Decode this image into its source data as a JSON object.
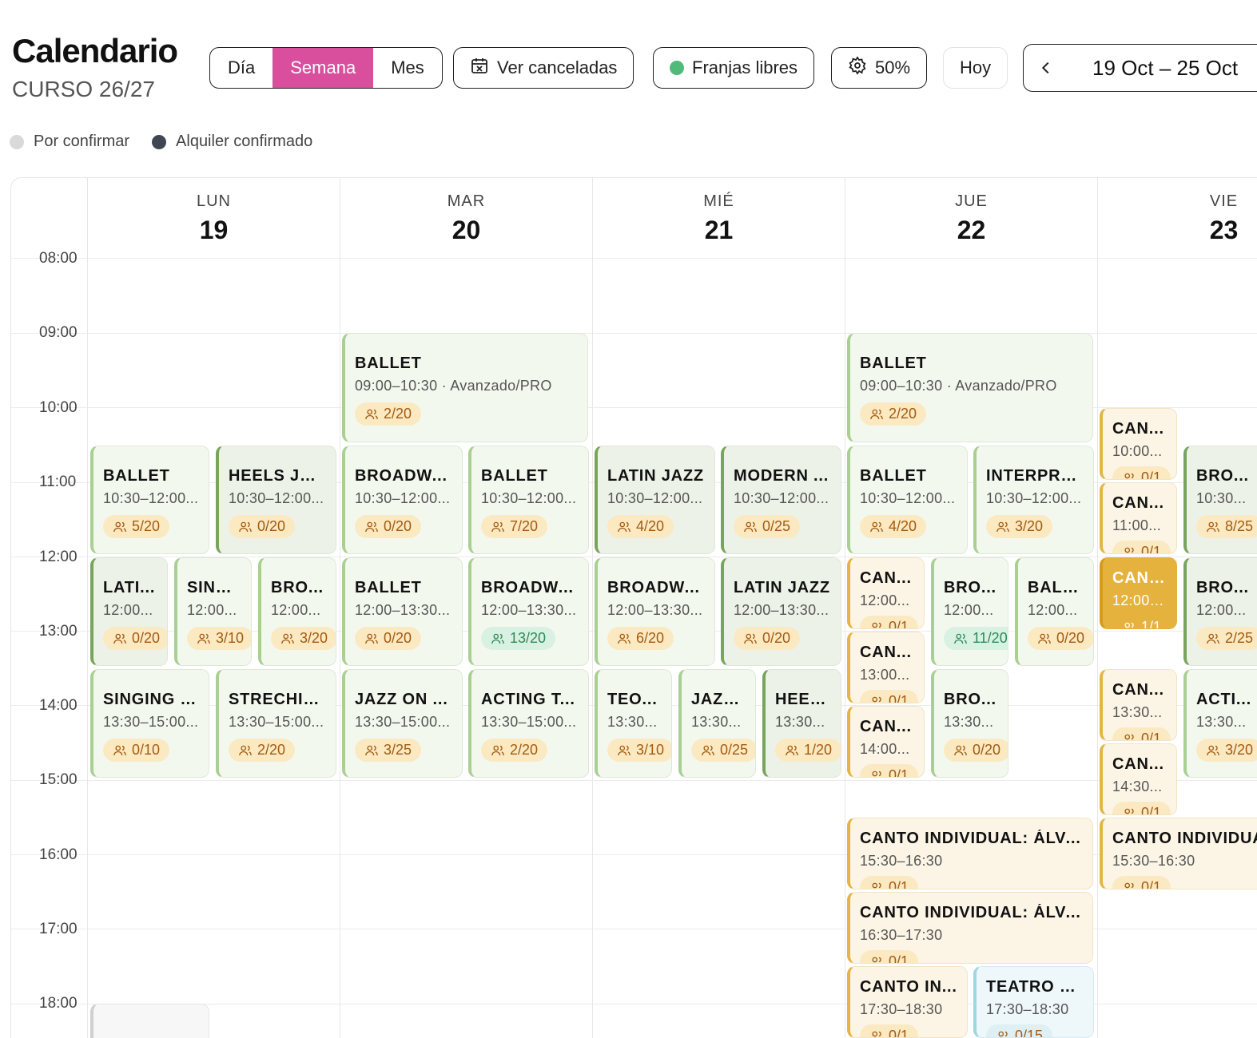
{
  "header": {
    "title": "Calendario",
    "subtitle": "CURSO 26/27"
  },
  "view_toggle": {
    "day": "Día",
    "week": "Semana",
    "month": "Mes",
    "selected": "Semana"
  },
  "toolbar": {
    "cancelled": "Ver canceladas",
    "free_slots": "Franjas libres",
    "zoom": "50%",
    "today": "Hoy",
    "range": "19 Oct – 25 Oct"
  },
  "legend": [
    {
      "label": "Por confirmar",
      "color": "#d9d9d9"
    },
    {
      "label": "Alquiler confirmado",
      "color": "#3f4752"
    }
  ],
  "colors": {
    "accent": "#d94f9e",
    "free_slot": "#4fba7a",
    "class_border": "#a9cf93",
    "individual": "#e4b545",
    "theatre": "#9fd6e4"
  },
  "days": [
    {
      "name": "LUN",
      "num": "19"
    },
    {
      "name": "MAR",
      "num": "20"
    },
    {
      "name": "MIÉ",
      "num": "21"
    },
    {
      "name": "JUE",
      "num": "22"
    },
    {
      "name": "VIE",
      "num": "23"
    }
  ],
  "hours": [
    "08:00",
    "09:00",
    "10:00",
    "11:00",
    "12:00",
    "13:00",
    "14:00",
    "15:00",
    "16:00",
    "17:00",
    "18:00"
  ],
  "events": {
    "mar_ballet_9": {
      "title": "BALLET",
      "sub": "09:00–10:30 · Avanzado/PRO",
      "count": "2/20"
    },
    "jue_ballet_9": {
      "title": "BALLET",
      "sub": "09:00–10:30 · Avanzado/PRO",
      "count": "2/20"
    },
    "lun_ballet_1030": {
      "title": "BALLET",
      "sub": "10:30–12:00...",
      "count": "5/20"
    },
    "lun_heels_1030": {
      "title": "HEELS JAZZ",
      "sub": "10:30–12:00...",
      "count": "0/20"
    },
    "mar_broadway_1030": {
      "title": "BROADWA...",
      "sub": "10:30–12:00...",
      "count": "0/20"
    },
    "mar_ballet_1030": {
      "title": "BALLET",
      "sub": "10:30–12:00...",
      "count": "7/20"
    },
    "mie_latin_1030": {
      "title": "LATIN JAZZ",
      "sub": "10:30–12:00...",
      "count": "4/20"
    },
    "mie_modern_1030": {
      "title": "MODERN ...",
      "sub": "10:30–12:00...",
      "count": "0/25"
    },
    "jue_ballet_1030": {
      "title": "BALLET",
      "sub": "10:30–12:00...",
      "count": "4/20"
    },
    "jue_interp_1030": {
      "title": "INTERPRE...",
      "sub": "10:30–12:00...",
      "count": "3/20"
    },
    "vie_can_10": {
      "title": "CAN...",
      "sub": "10:00...",
      "count": "0/1"
    },
    "vie_can_11": {
      "title": "CAN...",
      "sub": "11:00...",
      "count": "0/1"
    },
    "vie_bro_1030": {
      "title": "BRO...",
      "sub": "10:30...",
      "count": "8/25"
    },
    "lun_lati_12": {
      "title": "LATI...",
      "sub": "12:00...",
      "count": "0/20"
    },
    "lun_sing_12": {
      "title": "SING...",
      "sub": "12:00...",
      "count": "3/10"
    },
    "lun_bro_12": {
      "title": "BRO...",
      "sub": "12:00...",
      "count": "3/20"
    },
    "mar_ballet_12": {
      "title": "BALLET",
      "sub": "12:00–13:30...",
      "count": "0/20"
    },
    "mar_broadway_12": {
      "title": "BROADWA...",
      "sub": "12:00–13:30...",
      "count": "13/20"
    },
    "mie_broadway_12": {
      "title": "BROADWA...",
      "sub": "12:00–13:30...",
      "count": "6/20"
    },
    "mie_latin_12": {
      "title": "LATIN JAZZ",
      "sub": "12:00–13:30...",
      "count": "0/20"
    },
    "jue_can_12": {
      "title": "CAN...",
      "sub": "12:00...",
      "count": "0/1"
    },
    "jue_bro_12": {
      "title": "BRO...",
      "sub": "12:00...",
      "count": "11/20"
    },
    "jue_ball_12": {
      "title": "BALL...",
      "sub": "12:00...",
      "count": "0/20"
    },
    "jue_can_13": {
      "title": "CAN...",
      "sub": "13:00...",
      "count": "0/1"
    },
    "jue_can_14": {
      "title": "CAN...",
      "sub": "14:00...",
      "count": "0/1"
    },
    "jue_bro_1330": {
      "title": "BRO...",
      "sub": "13:30...",
      "count": "0/20"
    },
    "vie_cant_12": {
      "title": "CANT...",
      "sub": "12:00–...",
      "count": "1/1"
    },
    "vie_bro_12": {
      "title": "BRO...",
      "sub": "12:00...",
      "count": "2/25"
    },
    "vie_can_1330": {
      "title": "CAN...",
      "sub": "13:30...",
      "count": "0/1"
    },
    "vie_can_1430": {
      "title": "CAN...",
      "sub": "14:30...",
      "count": "0/1"
    },
    "vie_acti_1330": {
      "title": "ACTI...",
      "sub": "13:30...",
      "count": "3/20"
    },
    "lun_singing_1330": {
      "title": "SINGING T...",
      "sub": "13:30–15:00...",
      "count": "0/10"
    },
    "lun_strech_1330": {
      "title": "STRECHIN...",
      "sub": "13:30–15:00...",
      "count": "2/20"
    },
    "mar_jazzon_1330": {
      "title": "JAZZ ON ...",
      "sub": "13:30–15:00...",
      "count": "3/25"
    },
    "mar_acting_1330": {
      "title": "ACTING T...",
      "sub": "13:30–15:00...",
      "count": "2/20"
    },
    "mie_teo_1330": {
      "title": "TEO...",
      "sub": "13:30...",
      "count": "3/10"
    },
    "mie_jazz_1330": {
      "title": "JAZZ...",
      "sub": "13:30...",
      "count": "0/25"
    },
    "mie_heels_1330": {
      "title": "HEELS",
      "sub": "13:30...",
      "count": "1/20"
    },
    "jue_canto_1530": {
      "title": "CANTO INDIVIDUAL: ÁLVA...",
      "sub": "15:30–16:30",
      "count": "0/1"
    },
    "jue_canto_1630": {
      "title": "CANTO INDIVIDUAL: ÁLVA...",
      "sub": "16:30–17:30",
      "count": "0/1"
    },
    "jue_canto_1730": {
      "title": "CANTO IN...",
      "sub": "17:30–18:30",
      "count": "0/1"
    },
    "jue_teatro_1730": {
      "title": "TEATRO M...",
      "sub": "17:30–18:30",
      "count": "0/15"
    },
    "vie_canto_1530": {
      "title": "CANTO INDIVIDUA",
      "sub": "15:30–16:30",
      "count": "0/1"
    }
  }
}
